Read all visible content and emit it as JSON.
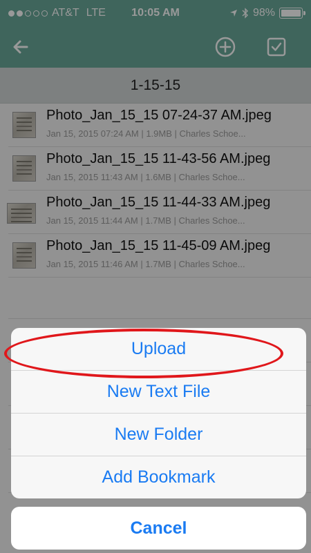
{
  "status_bar": {
    "carrier": "AT&T",
    "network": "LTE",
    "time": "10:05 AM",
    "battery": "98%"
  },
  "nav": {
    "back_icon": "back-arrow-icon",
    "add_icon": "plus-circle-icon",
    "select_icon": "checkbox-icon"
  },
  "folder": {
    "title": "1-15-15"
  },
  "files": [
    {
      "name": "Photo_Jan_15_15 07-24-37 AM.jpeg",
      "meta": "Jan 15, 2015 07:24 AM | 1.9MB | Charles Schoe..."
    },
    {
      "name": "Photo_Jan_15_15 11-43-56 AM.jpeg",
      "meta": "Jan 15, 2015 11:43 AM | 1.6MB | Charles Schoe..."
    },
    {
      "name": "Photo_Jan_15_15 11-44-33 AM.jpeg",
      "meta": "Jan 15, 2015 11:44 AM | 1.7MB | Charles Schoe..."
    },
    {
      "name": "Photo_Jan_15_15 11-45-09 AM.jpeg",
      "meta": "Jan 15, 2015 11:46 AM | 1.7MB | Charles Schoe..."
    }
  ],
  "action_sheet": {
    "upload": "Upload",
    "new_text_file": "New Text File",
    "new_folder": "New Folder",
    "add_bookmark": "Add Bookmark",
    "cancel": "Cancel"
  },
  "colors": {
    "nav_bar": "#6aa89a",
    "action_text": "#1a7bf2",
    "highlight": "#e0171b"
  }
}
